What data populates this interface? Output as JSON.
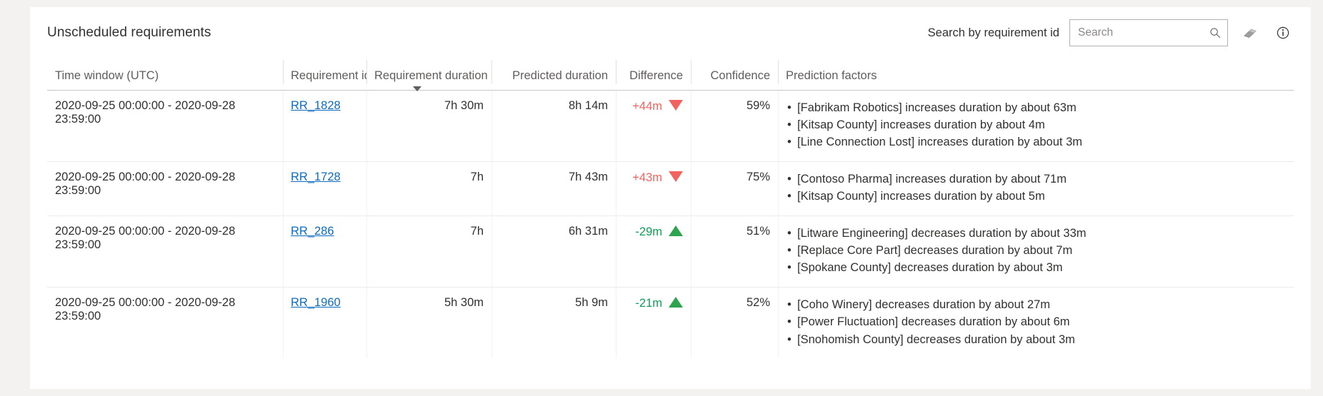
{
  "card": {
    "title": "Unscheduled requirements"
  },
  "search": {
    "label": "Search by requirement id",
    "placeholder": "Search",
    "value": "",
    "magnifier_icon": "search-icon",
    "eraser_icon": "eraser-icon",
    "info_icon": "info-icon"
  },
  "table": {
    "columns": [
      {
        "key": "time_window",
        "label": "Time window (UTC)",
        "align": "left",
        "divided": false,
        "sorted": false
      },
      {
        "key": "requirement_id",
        "label": "Requirement id",
        "align": "left",
        "divided": true,
        "sorted": false
      },
      {
        "key": "requirement_duration",
        "label": "Requirement duration",
        "align": "right",
        "divided": true,
        "sorted": true,
        "sort_direction": "desc"
      },
      {
        "key": "predicted_duration",
        "label": "Predicted duration",
        "align": "right",
        "divided": true,
        "sorted": false
      },
      {
        "key": "difference",
        "label": "Difference",
        "align": "right",
        "divided": true,
        "sorted": false
      },
      {
        "key": "confidence",
        "label": "Confidence",
        "align": "right",
        "divided": true,
        "sorted": false
      },
      {
        "key": "prediction_factors",
        "label": "Prediction factors",
        "align": "left",
        "divided": true,
        "sorted": false
      }
    ],
    "rows": [
      {
        "time_window": "2020-09-25 00:00:00 - 2020-09-28 23:59:00",
        "requirement_id": "RR_1828",
        "requirement_duration": "7h 30m",
        "predicted_duration": "8h 14m",
        "difference": "+44m",
        "difference_direction": "up",
        "confidence": "59%",
        "prediction_factors": [
          "[Fabrikam Robotics] increases duration by about 63m",
          "[Kitsap County] increases duration by about 4m",
          "[Line Connection Lost] increases duration by about 3m"
        ]
      },
      {
        "time_window": "2020-09-25 00:00:00 - 2020-09-28 23:59:00",
        "requirement_id": "RR_1728",
        "requirement_duration": "7h",
        "predicted_duration": "7h 43m",
        "difference": "+43m",
        "difference_direction": "up",
        "confidence": "75%",
        "prediction_factors": [
          "[Contoso Pharma] increases duration by about 71m",
          "[Kitsap County] increases duration by about 5m"
        ]
      },
      {
        "time_window": "2020-09-25 00:00:00 - 2020-09-28 23:59:00",
        "requirement_id": "RR_286",
        "requirement_duration": "7h",
        "predicted_duration": "6h 31m",
        "difference": "-29m",
        "difference_direction": "down",
        "confidence": "51%",
        "prediction_factors": [
          "[Litware Engineering] decreases duration by about 33m",
          "[Replace Core Part] decreases duration by about 7m",
          "[Spokane County] decreases duration by about 3m"
        ]
      },
      {
        "time_window": "2020-09-25 00:00:00 - 2020-09-28 23:59:00",
        "requirement_id": "RR_1960",
        "requirement_duration": "5h 30m",
        "predicted_duration": "5h 9m",
        "difference": "-21m",
        "difference_direction": "down",
        "confidence": "52%",
        "prediction_factors": [
          "[Coho Winery] decreases duration by about 27m",
          "[Power Fluctuation] decreases duration by about 6m",
          "[Snohomish County] decreases duration by about 3m"
        ]
      }
    ]
  },
  "colors": {
    "link": "#0f6cbd",
    "increase": "#f2635f",
    "decrease": "#0f9d58",
    "page_background": "#f3f2f1",
    "card_background": "#ffffff"
  }
}
